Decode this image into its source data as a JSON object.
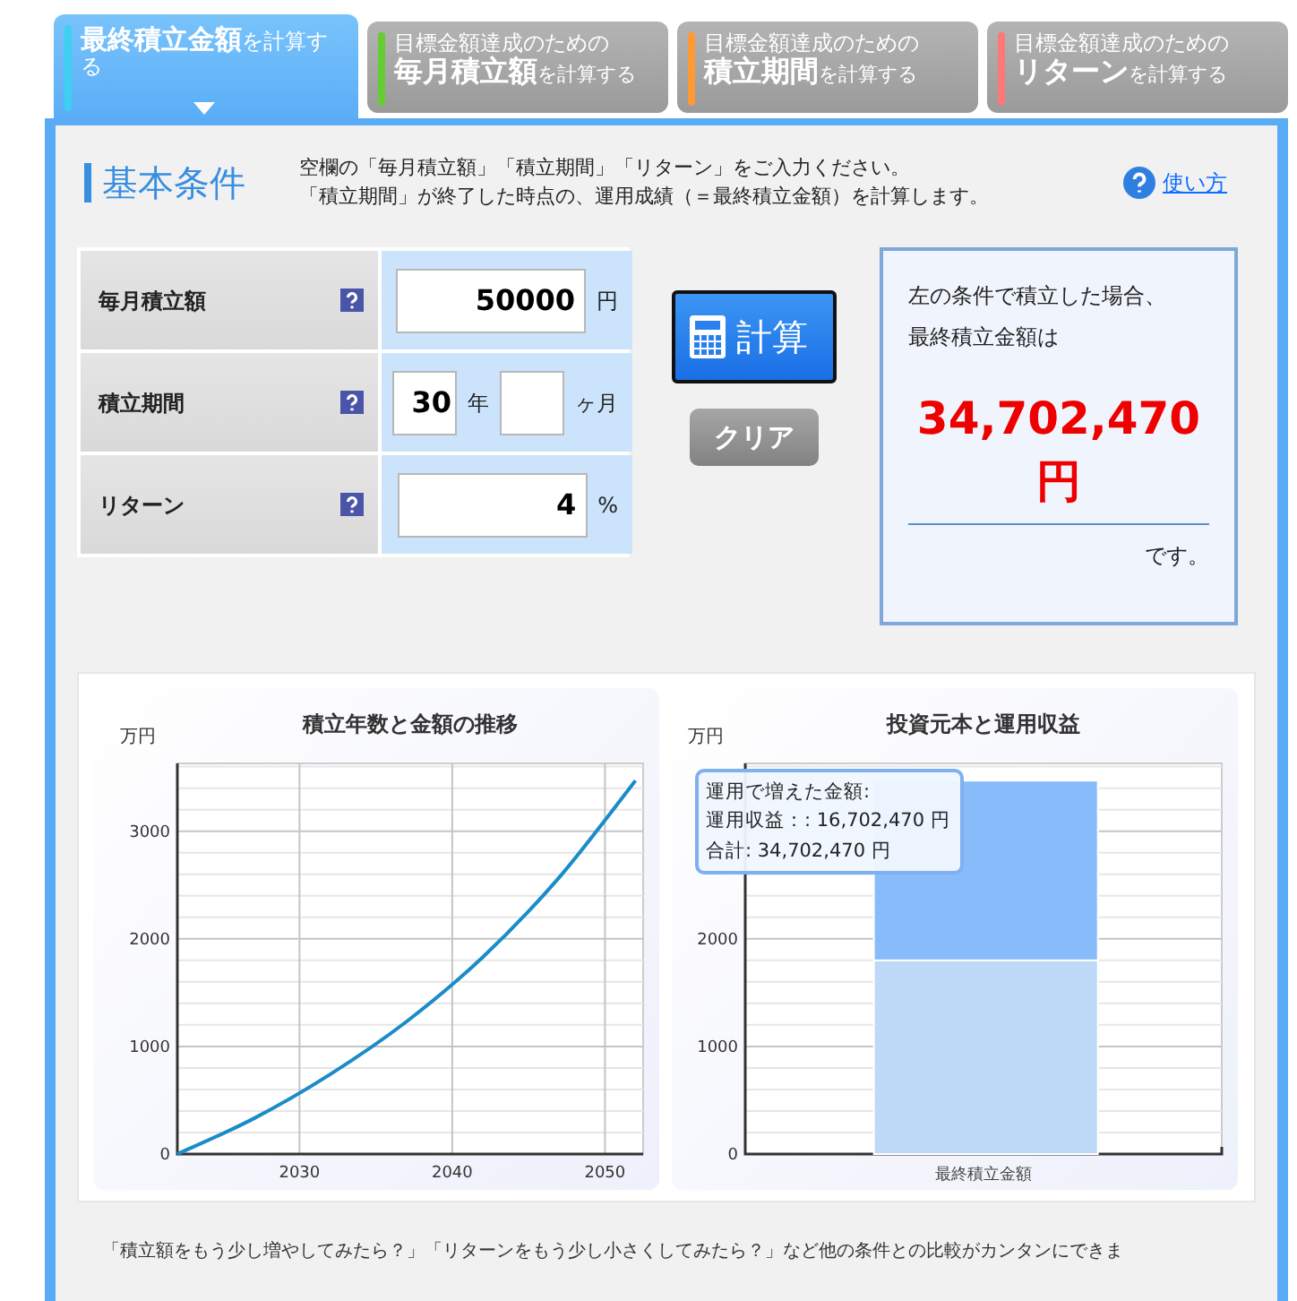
{
  "tabs": [
    {
      "main": "最終積立金額",
      "suffix": "を計算する",
      "color": "#3dd0f0",
      "selected": true
    },
    {
      "lead": "目標金額達成のための",
      "main": "毎月積立額",
      "suffix": "を計算する",
      "color": "#66cc33",
      "selected": false
    },
    {
      "lead": "目標金額達成のための",
      "main": "積立期間",
      "suffix": "を計算する",
      "color": "#ff9933",
      "selected": false
    },
    {
      "lead": "目標金額達成のための",
      "main": "リターン",
      "suffix": "を計算する",
      "color": "#ff7777",
      "selected": false
    }
  ],
  "section": {
    "title": "基本条件",
    "description": [
      "空欄の「毎月積立額」「積立期間」「リターン」をご入力ください。",
      "「積立期間」が終了した時点の、運用成績（＝最終積立金額）を計算します。"
    ],
    "help_link": "使い方"
  },
  "form": {
    "rows": [
      {
        "label": "毎月積立額",
        "inputs": [
          {
            "value": "50000",
            "unit": "円"
          }
        ]
      },
      {
        "label": "積立期間",
        "inputs": [
          {
            "value": "30",
            "unit": "年"
          },
          {
            "unit": "ヶ月"
          }
        ]
      },
      {
        "label": "リターン",
        "inputs": [
          {
            "value": "4",
            "unit": "%"
          }
        ]
      }
    ]
  },
  "buttons": {
    "calculate": "計算",
    "clear": "クリア"
  },
  "result": {
    "lines": [
      "左の条件で積立した場合、",
      "最終積立金額は"
    ],
    "amount": "34,702,470",
    "unit": "円",
    "suffix": "です。"
  },
  "charts": [
    {
      "chart_data": {
        "type": "line",
        "title": "積立年数と金額の推移",
        "ylabel": "万円",
        "x": [
          2022,
          2027,
          2032,
          2037,
          2042,
          2047,
          2052
        ],
        "series": [
          {
            "color": "#1a8cc8",
            "values": [
              0,
              330,
              740,
              1230,
              1830,
              2570,
              3470
            ]
          }
        ],
        "xlim": [
          2022,
          2052.5
        ],
        "ylim": [
          0,
          3630
        ],
        "xticks": [
          2030,
          2040,
          2050
        ],
        "yticks": [
          0,
          1000,
          2000,
          3000
        ],
        "grid": true
      }
    },
    {
      "chart_data": {
        "type": "bar",
        "title": "投資元本と運用収益",
        "ylabel": "万円",
        "categories": [
          "最終積立金額"
        ],
        "series": [
          {
            "color": "#bdd9f7",
            "values": [
              1800
            ]
          },
          {
            "color": "#88bbfa",
            "values": [
              1670
            ]
          }
        ],
        "stacked": true,
        "ylim": [
          0,
          3630
        ],
        "yticks": [
          0,
          1000,
          2000
        ],
        "grid": true
      },
      "tooltip": [
        "運用で増えた金額:",
        "運用収益：: 16,702,470 円",
        "合計:  34,702,470 円"
      ]
    }
  ],
  "footer": "「積立額をもう少し増やしてみたら？」「リターンをもう少し小さくしてみたら？」など他の条件との比較がカンタンにできま"
}
